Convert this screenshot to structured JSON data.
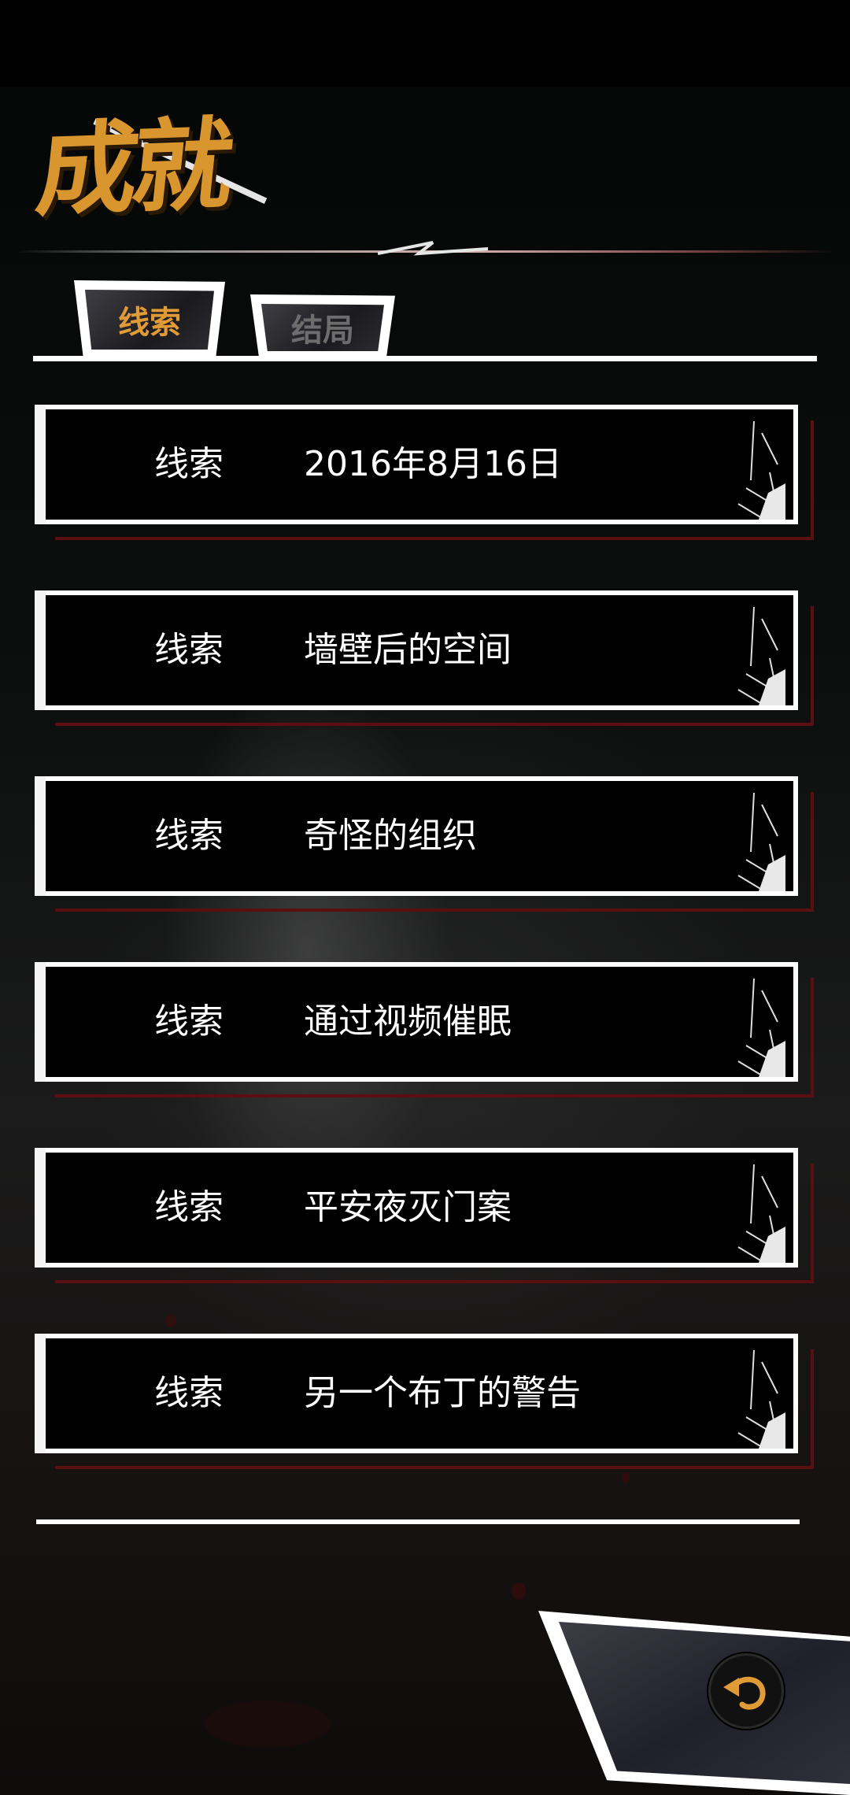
{
  "screen": {
    "title": "成就",
    "tabs": [
      {
        "label": "线索",
        "active": true
      },
      {
        "label": "结局",
        "active": false
      }
    ],
    "clues": [
      {
        "label": "线索",
        "title": "2016年8月16日"
      },
      {
        "label": "线索",
        "title": "墙壁后的空间"
      },
      {
        "label": "线索",
        "title": "奇怪的组织"
      },
      {
        "label": "线索",
        "title": "通过视频催眠"
      },
      {
        "label": "线索",
        "title": "平安夜灭门案"
      },
      {
        "label": "线索",
        "title": "另一个布丁的警告"
      }
    ],
    "back_button_icon": "curved-back-arrow-icon"
  },
  "colors": {
    "accent": "#d9962e",
    "tab_inactive_text": "#6d6d6d",
    "card_shadow": "#5a1010",
    "card_border": "#ffffff"
  }
}
